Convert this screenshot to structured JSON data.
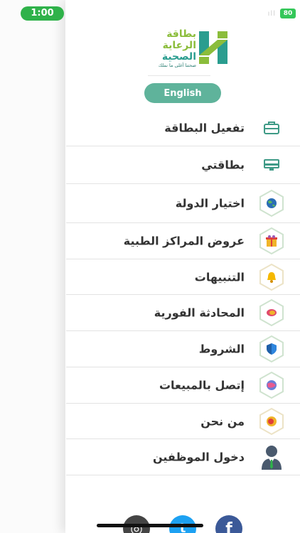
{
  "status_bar": {
    "time": "1:00",
    "battery": "80"
  },
  "logo": {
    "line1": "بطاقة",
    "line2": "الرعاية",
    "line3": "الصحية",
    "tagline": "صحتنا أغلى ما نملك",
    "colors": {
      "green": "#8bbd3b",
      "teal": "#2a9d8f"
    }
  },
  "language_button": "English",
  "menu": [
    {
      "label": "تفعيل البطاقة",
      "icon": "briefcase-icon"
    },
    {
      "label": "بطاقتي",
      "icon": "card-icon"
    },
    {
      "label": "اختيار الدولة",
      "icon": "globe-icon"
    },
    {
      "label": "عروض المراكز الطبية",
      "icon": "gift-icon"
    },
    {
      "label": "التنبيهات",
      "icon": "bell-icon"
    },
    {
      "label": "المحادثة الفورية",
      "icon": "chat-icon"
    },
    {
      "label": "الشروط",
      "icon": "shield-icon"
    },
    {
      "label": "إتصل بالمبيعات",
      "icon": "phone-icon"
    },
    {
      "label": "من نحن",
      "icon": "info-icon"
    },
    {
      "label": "دخول الموظفين",
      "icon": "employee-icon"
    }
  ],
  "social": [
    {
      "name": "facebook",
      "glyph": "f",
      "color": "#3b5998"
    },
    {
      "name": "twitter",
      "glyph": "t",
      "color": "#1da1f2"
    },
    {
      "name": "instagram",
      "glyph": "◎",
      "color": "#444444"
    }
  ],
  "colors": {
    "accent": "#5fb39b",
    "time_pill": "#2fb24a",
    "text": "#333333"
  }
}
